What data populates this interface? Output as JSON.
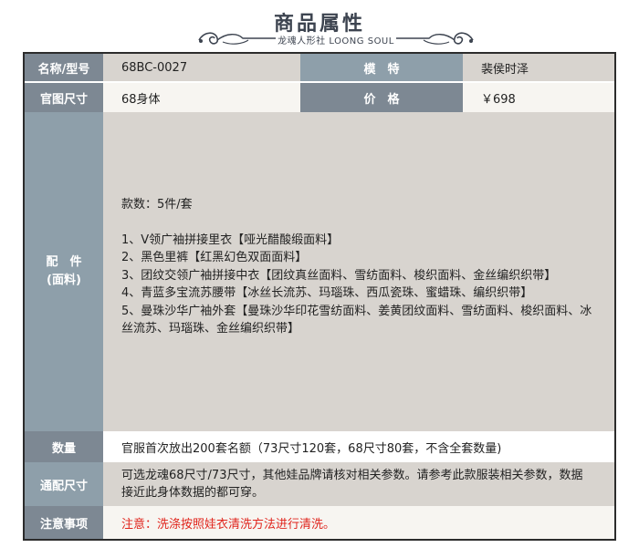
{
  "header": {
    "title": "商品属性",
    "subtitle": "龙魂人形社 LOONG SOUL"
  },
  "rows": {
    "model": {
      "label": "名称/型号",
      "value": "68BC-0027"
    },
    "mold": {
      "label": "模　特",
      "value": "裴侯时泽"
    },
    "size": {
      "label": "官图尺寸",
      "value": "68身体"
    },
    "price": {
      "label": "价　格",
      "value": "￥698"
    },
    "parts": {
      "label_line1": "配　件",
      "label_line2": "(面料)",
      "count": "款数：5件/套",
      "items": [
        "1、V领广袖拼接里衣【哑光醋酸缎面料】",
        "2、黑色里裤【红黑幻色双面面料】",
        "3、团纹交领广袖拼接中衣【团纹真丝面料、雪纺面料、梭织面料、金丝编织织带】",
        "4、青蓝多宝流苏腰带【冰丝长流苏、玛瑙珠、西瓜瓷珠、蜜蜡珠、编织织带】",
        "5、曼珠沙华广袖外套【曼珠沙华印花雪纺面料、姜黄团纹面料、雪纺面料、梭织面料、冰",
        "丝流苏、玛瑙珠、金丝编织织带】"
      ]
    },
    "quantity": {
      "label": "数量",
      "value": "官服首次放出200套名额（73尺寸120套，68尺寸80套，不含全套数量)"
    },
    "fit": {
      "label": "通配尺寸",
      "line1": "可选龙魂68尺寸/73尺寸，其他娃品牌请核对相关参数。请参考此款服装相关参数，数据",
      "line2": "接近此身体数据的都可穿。"
    },
    "notice": {
      "label": "注意事项",
      "value": "注意：洗涤按照娃衣清洗方法进行清洗。"
    }
  },
  "colors": {
    "label_dark": "#7d8893",
    "label_blue": "#8e9faa",
    "value_gray": "#d8d4cf",
    "value_light": "#f7f5f1",
    "notice_red": "#e0241c",
    "title": "#3d4450"
  }
}
